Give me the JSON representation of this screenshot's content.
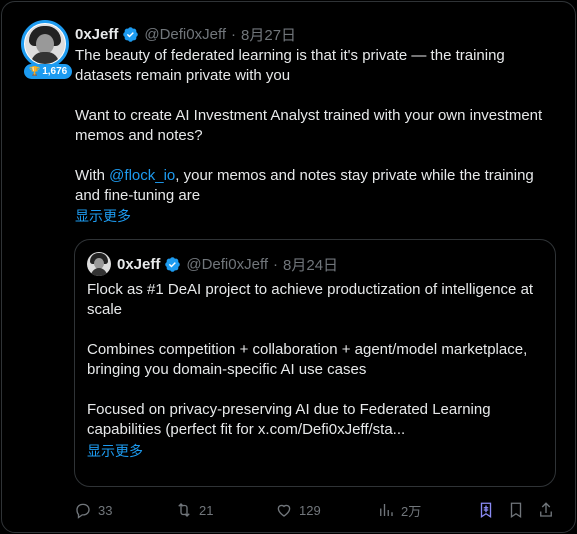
{
  "tweet": {
    "author_name": "0xJeff",
    "handle": "@Defi0xJeff",
    "separator": "·",
    "date": "8月27日",
    "badge_count": "1,676",
    "paragraph1": "The beauty of federated learning is that it's private — the training datasets remain private with you",
    "paragraph2": "Want to create AI Investment Analyst trained with your own investment memos and notes?",
    "paragraph3_prefix": "With ",
    "paragraph3_mention": "@flock_io",
    "paragraph3_suffix": ", your memos and notes stay private while the training and fine-tuning are",
    "show_more": "显示更多"
  },
  "quote": {
    "author_name": "0xJeff",
    "handle": "@Defi0xJeff",
    "separator": "·",
    "date": "8月24日",
    "paragraph1": "Flock as #1 DeAI project to achieve productization of intelligence at scale",
    "paragraph2": "Combines competition + collaboration + agent/model marketplace, bringing you domain-specific AI use cases",
    "paragraph3": "Focused on privacy-preserving AI due to Federated Learning capabilities (perfect fit for x.com/Defi0xJeff/sta...",
    "show_more": "显示更多"
  },
  "actions": {
    "replies": "33",
    "reposts": "21",
    "likes": "129",
    "views": "2万"
  },
  "colors": {
    "accent": "#1d9bf0",
    "muted": "#71767b",
    "text": "#e7e9ea",
    "grok_icon": "#8b8bf5"
  }
}
